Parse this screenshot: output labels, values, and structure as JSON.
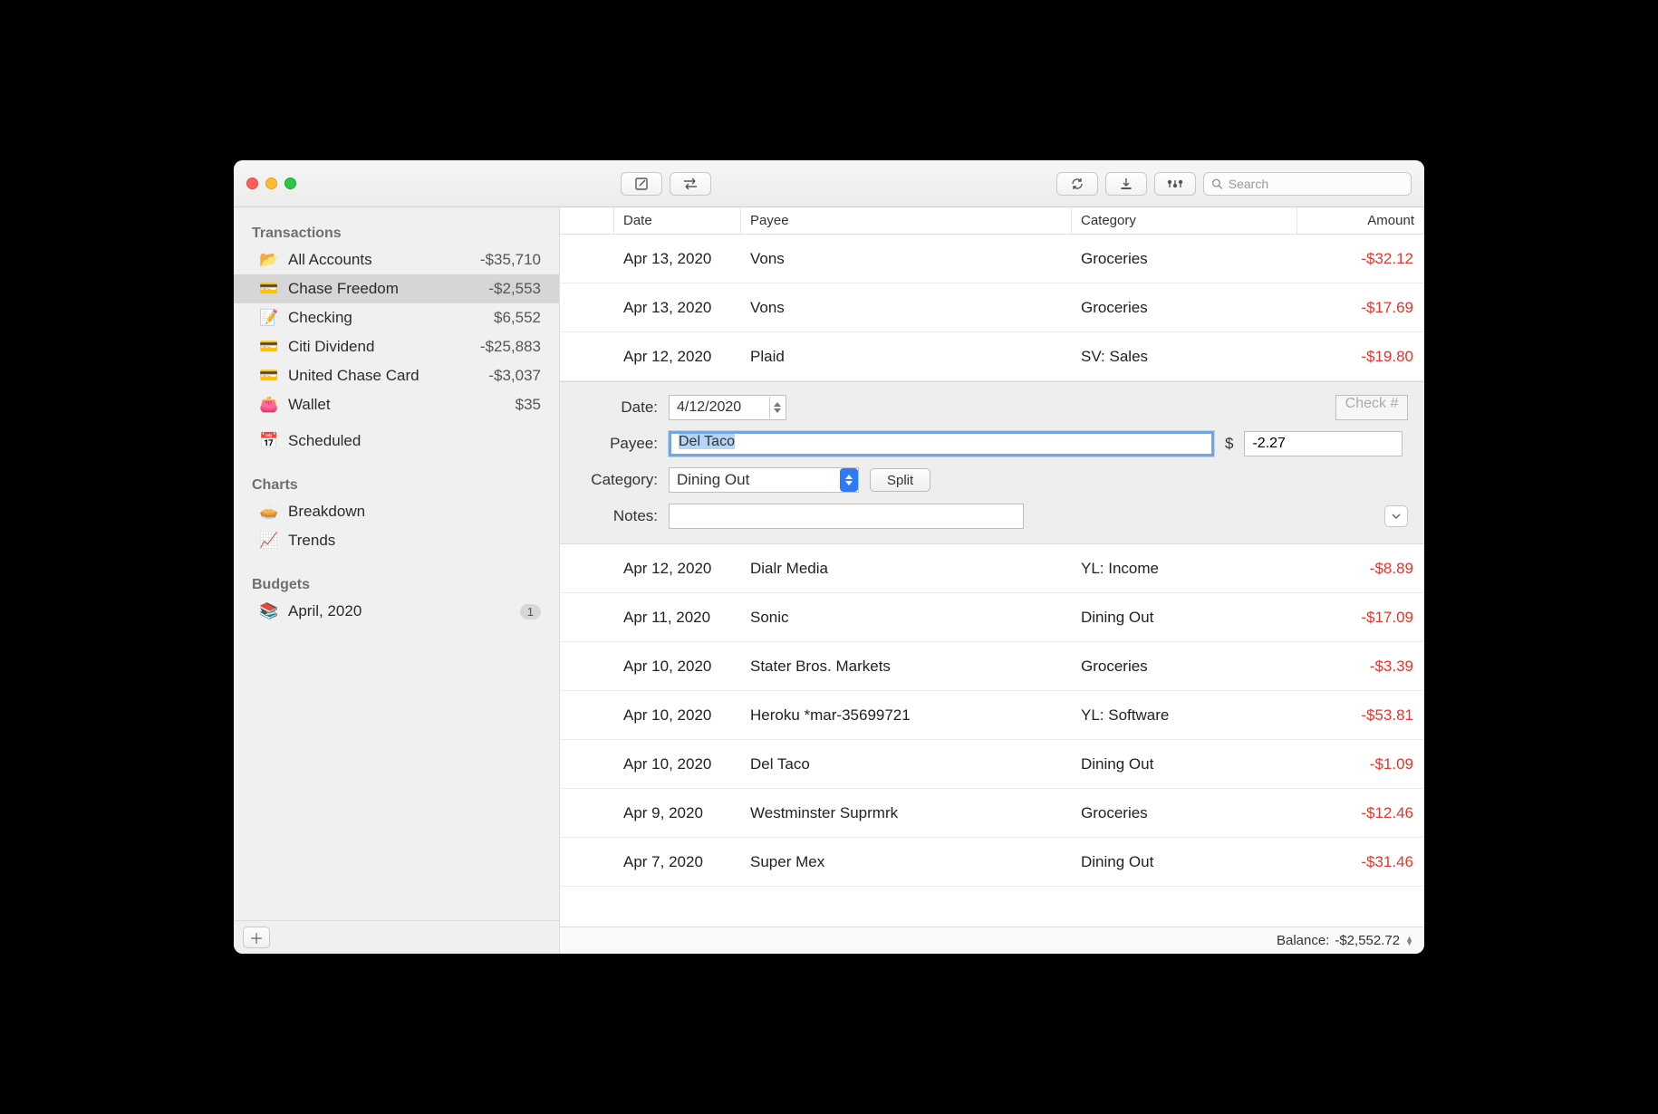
{
  "search": {
    "placeholder": "Search"
  },
  "sidebar": {
    "transactions_heading": "Transactions",
    "charts_heading": "Charts",
    "budgets_heading": "Budgets",
    "accounts": [
      {
        "icon": "📂",
        "label": "All Accounts",
        "amount": "-$35,710"
      },
      {
        "icon": "💳",
        "label": "Chase Freedom",
        "amount": "-$2,553",
        "selected": true
      },
      {
        "icon": "📝",
        "label": "Checking",
        "amount": "$6,552"
      },
      {
        "icon": "💳",
        "label": "Citi Dividend",
        "amount": "-$25,883"
      },
      {
        "icon": "💳",
        "label": "United Chase Card",
        "amount": "-$3,037"
      },
      {
        "icon": "👛",
        "label": "Wallet",
        "amount": "$35"
      }
    ],
    "scheduled": {
      "icon": "📅",
      "label": "Scheduled"
    },
    "charts": [
      {
        "icon": "🥧",
        "label": "Breakdown"
      },
      {
        "icon": "📈",
        "label": "Trends"
      }
    ],
    "budgets": [
      {
        "icon": "📚",
        "label": "April, 2020",
        "badge": "1"
      }
    ]
  },
  "columns": {
    "date": "Date",
    "payee": "Payee",
    "category": "Category",
    "amount": "Amount"
  },
  "rows_before": [
    {
      "date": "Apr 13, 2020",
      "payee": "Vons",
      "category": "Groceries",
      "amount": "-$32.12"
    },
    {
      "date": "Apr 13, 2020",
      "payee": "Vons",
      "category": "Groceries",
      "amount": "-$17.69"
    },
    {
      "date": "Apr 12, 2020",
      "payee": "Plaid",
      "category": "SV: Sales",
      "amount": "-$19.80"
    }
  ],
  "editor": {
    "date_label": "Date:",
    "date_value": "4/12/2020",
    "check_placeholder": "Check #",
    "payee_label": "Payee:",
    "payee_value": "Del Taco",
    "currency": "$",
    "amount_value": "-2.27",
    "category_label": "Category:",
    "category_value": "Dining Out",
    "split_label": "Split",
    "notes_label": "Notes:",
    "notes_value": ""
  },
  "rows_after": [
    {
      "date": "Apr 12, 2020",
      "payee": "Dialr Media",
      "category": "YL: Income",
      "amount": "-$8.89"
    },
    {
      "date": "Apr 11, 2020",
      "payee": "Sonic",
      "category": "Dining Out",
      "amount": "-$17.09"
    },
    {
      "date": "Apr 10, 2020",
      "payee": "Stater Bros. Markets",
      "category": "Groceries",
      "amount": "-$3.39"
    },
    {
      "date": "Apr 10, 2020",
      "payee": "Heroku *mar-35699721",
      "category": "YL: Software",
      "amount": "-$53.81"
    },
    {
      "date": "Apr 10, 2020",
      "payee": "Del Taco",
      "category": "Dining Out",
      "amount": "-$1.09"
    },
    {
      "date": "Apr 9, 2020",
      "payee": "Westminster Suprmrk",
      "category": "Groceries",
      "amount": "-$12.46"
    },
    {
      "date": "Apr 7, 2020",
      "payee": "Super Mex",
      "category": "Dining Out",
      "amount": "-$31.46"
    }
  ],
  "status": {
    "balance_label": "Balance:",
    "balance_value": "-$2,552.72"
  }
}
